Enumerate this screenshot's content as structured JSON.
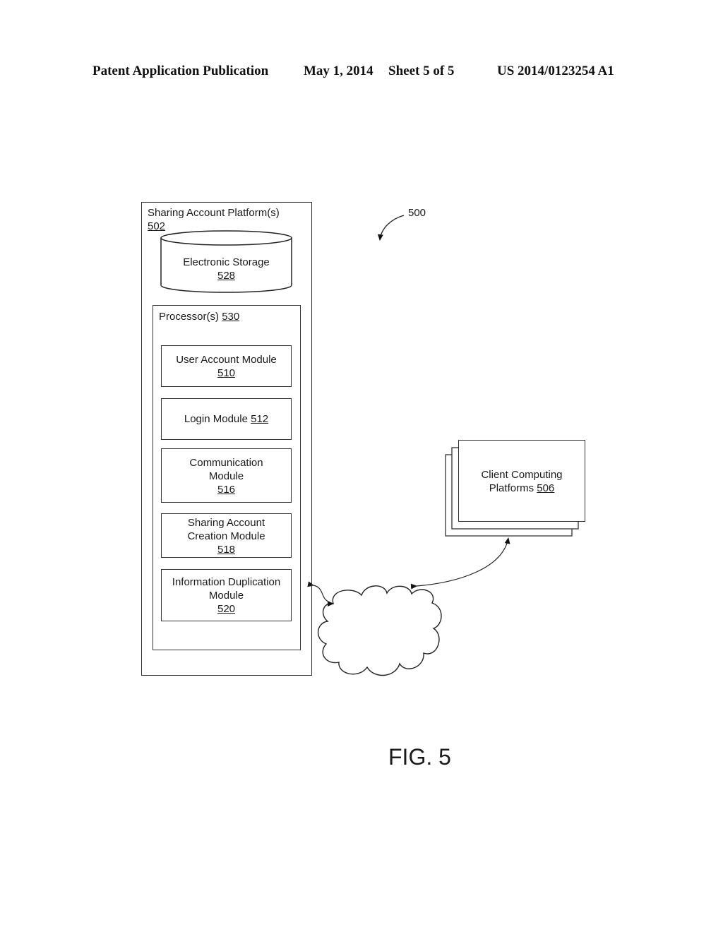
{
  "header": {
    "publication": "Patent Application Publication",
    "date": "May 1, 2014",
    "sheet": "Sheet 5 of 5",
    "number": "US 2014/0123254 A1"
  },
  "figure": {
    "ref": "500",
    "caption": "FIG. 5",
    "platform": {
      "title": "Sharing Account Platform(s)",
      "ref": "502"
    },
    "storage": {
      "title": "Electronic Storage",
      "ref": "528"
    },
    "processor": {
      "title": "Processor(s)",
      "ref": "530"
    },
    "modules": [
      {
        "line1": "User Account Module",
        "line2": "",
        "ref": "510"
      },
      {
        "line1": "Login Module",
        "line2": "",
        "ref": "512"
      },
      {
        "line1": "Communication",
        "line2": "Module",
        "ref": "516"
      },
      {
        "line1": "Sharing Account",
        "line2": "Creation Module",
        "ref": "518"
      },
      {
        "line1": "Information Duplication",
        "line2": "Module",
        "ref": "520"
      }
    ],
    "client": {
      "line1": "Client Computing",
      "line2": "Platforms",
      "ref": "506"
    },
    "network": {
      "icon": "cloud-icon"
    }
  }
}
